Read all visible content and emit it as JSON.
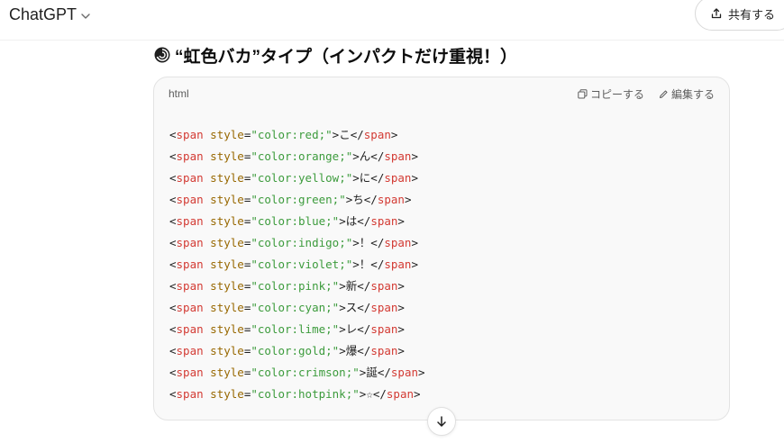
{
  "header": {
    "model_label": "ChatGPT",
    "share_label": "共有する"
  },
  "message": {
    "heading_text": "“虹色バカ”タイプ（インパクトだけ重視！）"
  },
  "code_block": {
    "language": "html",
    "copy_label": "コピーする",
    "edit_label": "編集する",
    "lines": [
      {
        "color": "red",
        "char": "こ"
      },
      {
        "color": "orange",
        "char": "ん"
      },
      {
        "color": "yellow",
        "char": "に"
      },
      {
        "color": "green",
        "char": "ち"
      },
      {
        "color": "blue",
        "char": "は"
      },
      {
        "color": "indigo",
        "char": "！"
      },
      {
        "color": "violet",
        "char": "！"
      },
      {
        "color": "pink",
        "char": "新"
      },
      {
        "color": "cyan",
        "char": "ス"
      },
      {
        "color": "lime",
        "char": "レ"
      },
      {
        "color": "gold",
        "char": "爆"
      },
      {
        "color": "crimson",
        "char": "誕"
      },
      {
        "color": "hotpink",
        "char": "☆"
      }
    ]
  },
  "icons": {
    "model_chevron": "chevron-down-icon",
    "share": "share-icon",
    "heading_emoji": "rainbow-swirl-emoji-icon",
    "copy": "copy-icon",
    "edit": "pencil-icon",
    "scroll": "arrow-down-icon"
  },
  "colors": {
    "tag": "#d33a33",
    "attribute": "#986801",
    "string": "#3c9b3c",
    "card_background": "#f9f9f9"
  }
}
